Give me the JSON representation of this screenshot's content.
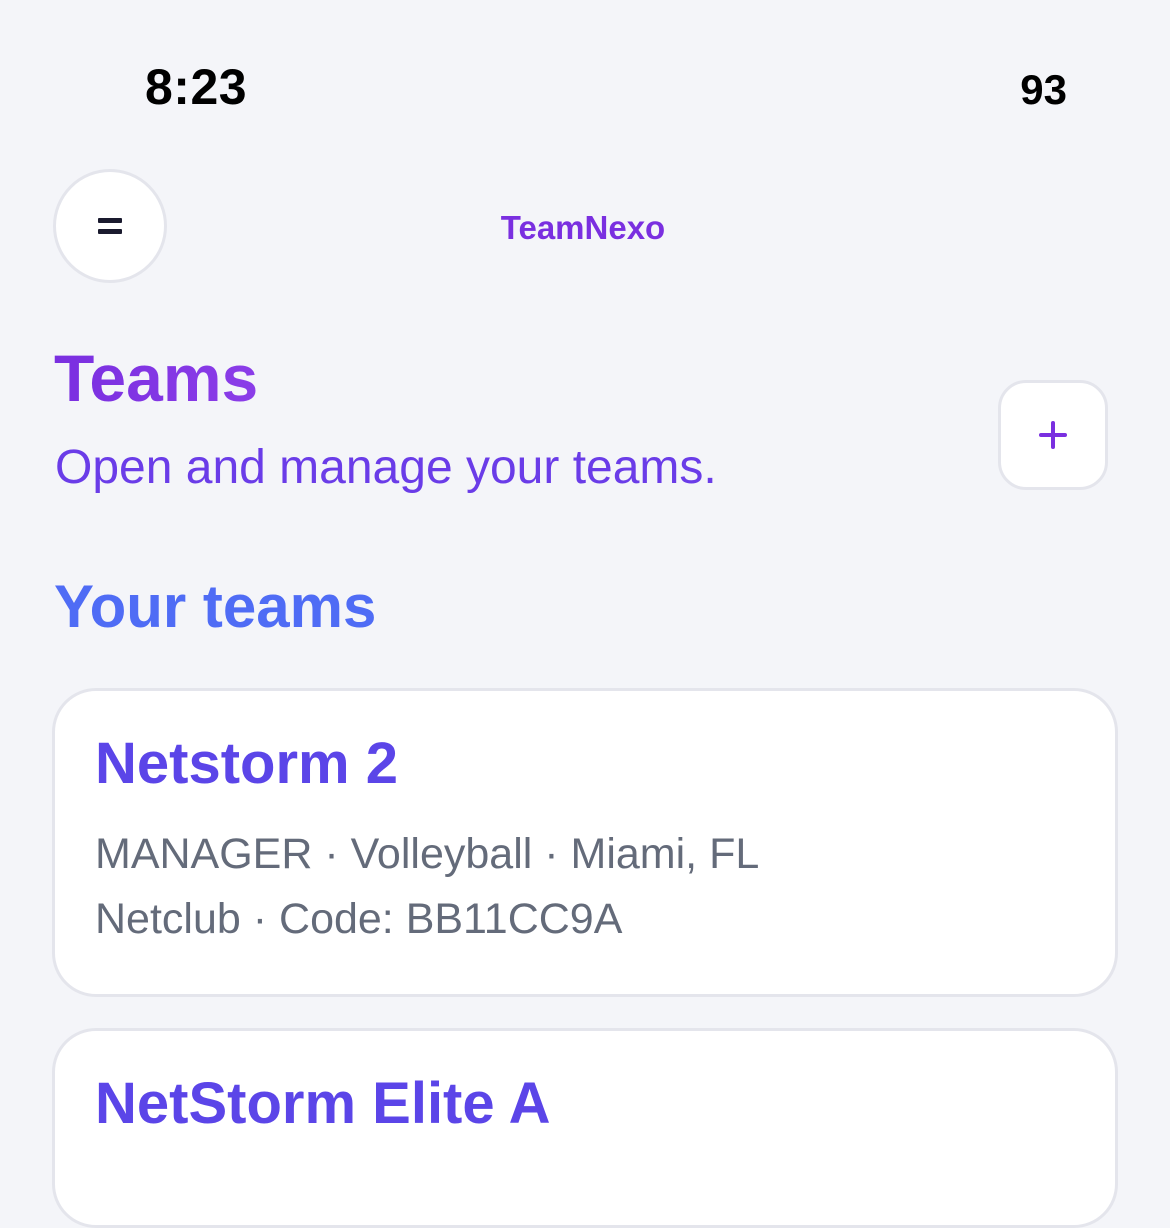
{
  "status_bar": {
    "time": "8:23",
    "battery": "93"
  },
  "header": {
    "menu_icon": "menu-icon",
    "brand": "TeamNexo"
  },
  "page": {
    "title": "Teams",
    "subtitle": "Open and manage your teams.",
    "add_icon": "plus-icon"
  },
  "section": {
    "title": "Your teams"
  },
  "teams": [
    {
      "name": "Netstorm 2",
      "meta_line1": "MANAGER · Volleyball · Miami, FL",
      "meta_line2": "Netclub · Code: BB11CC9A"
    },
    {
      "name": "NetStorm Elite A"
    }
  ],
  "colors": {
    "background": "#f4f5f9",
    "brand": "#7a2fe0",
    "subtitle": "#6a3ce8",
    "section_title": "#4f6cf5",
    "team_name": "#5b45e8",
    "meta_text": "#646b7a"
  }
}
